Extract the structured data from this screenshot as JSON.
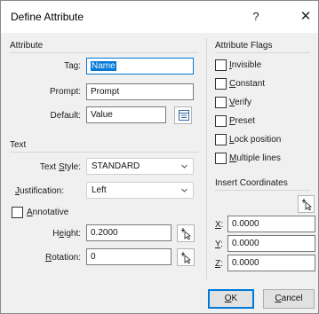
{
  "dialog": {
    "title": "Define Attribute",
    "help": "?",
    "close": "✕"
  },
  "attribute": {
    "section_label": "Attribute",
    "tag_label": "Tag:",
    "tag_value": "Name",
    "prompt_label": "Prompt:",
    "prompt_value": "Prompt",
    "default_label": "Default:",
    "default_value": "Value"
  },
  "text": {
    "section_label": "Text",
    "style_label_pre": "Text ",
    "style_label_u": "S",
    "style_label_post": "tyle:",
    "style_value": "STANDARD",
    "just_label_u": "J",
    "just_label_post": "ustification:",
    "just_value": "Left",
    "annotative_u": "A",
    "annotative_post": "nnotative",
    "height_pre": "H",
    "height_u": "e",
    "height_post": "ight:",
    "height_value": "0.2000",
    "rotation_u": "R",
    "rotation_post": "otation:",
    "rotation_value": "0"
  },
  "flags": {
    "section_label": "Attribute Flags",
    "items": [
      {
        "u": "I",
        "rest": "nvisible",
        "checked": false
      },
      {
        "u": "C",
        "rest": "onstant",
        "checked": false
      },
      {
        "u": "V",
        "rest": "erify",
        "checked": false
      },
      {
        "u": "P",
        "rest": "reset",
        "checked": false
      },
      {
        "u": "L",
        "rest": "ock position",
        "checked": false
      },
      {
        "u": "M",
        "rest": "ultiple lines",
        "checked": false
      }
    ]
  },
  "insert": {
    "section_label": "Insert Coordinates",
    "x_label_u": "X",
    "x_value": "0.0000",
    "y_label_u": "Y",
    "y_value": "0.0000",
    "z_label_u": "Z",
    "z_value": "0.0000"
  },
  "buttons": {
    "ok_u": "O",
    "ok_rest": "K",
    "cancel_u": "C",
    "cancel_rest": "ancel"
  }
}
